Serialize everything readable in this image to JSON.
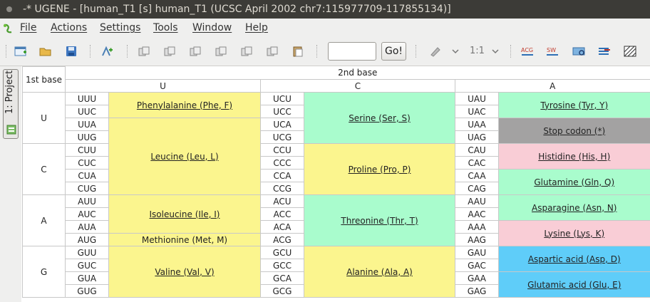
{
  "window": {
    "title": "-* UGENE - [human_T1 [s] human_T1 (UCSC April 2002 chr7:115977709-117855134)]"
  },
  "menu": [
    "File",
    "Actions",
    "Settings",
    "Tools",
    "Window",
    "Help"
  ],
  "toolbar": {
    "go_label": "Go!",
    "zoom_label": "1:1",
    "goto_value": ""
  },
  "side_panel": {
    "project_tab": "1: Project"
  },
  "table": {
    "first_base_header": "1st base",
    "second_base_header": "2nd base",
    "second_bases": [
      "U",
      "C",
      "A"
    ],
    "rows": [
      {
        "base": "U",
        "codons": [
          [
            "UUU",
            "UUC",
            "UUA",
            "UUG"
          ],
          [
            "UCU",
            "UCC",
            "UCA",
            "UCG"
          ],
          [
            "UAU",
            "UAC",
            "UAA",
            "UAG"
          ]
        ]
      },
      {
        "base": "C",
        "codons": [
          [
            "CUU",
            "CUC",
            "CUA",
            "CUG"
          ],
          [
            "CCU",
            "CCC",
            "CCA",
            "CCG"
          ],
          [
            "CAU",
            "CAC",
            "CAA",
            "CAG"
          ]
        ]
      },
      {
        "base": "A",
        "codons": [
          [
            "AUU",
            "AUC",
            "AUA",
            "AUG"
          ],
          [
            "ACU",
            "ACC",
            "ACA",
            "ACG"
          ],
          [
            "AAU",
            "AAC",
            "AAA",
            "AAG"
          ]
        ]
      },
      {
        "base": "G",
        "codons": [
          [
            "GUU",
            "GUC",
            "GUA",
            "GUG"
          ],
          [
            "GCU",
            "GCC",
            "GCA",
            "GCG"
          ],
          [
            "GAU",
            "GAC",
            "GAA",
            "GAG"
          ]
        ]
      }
    ],
    "amino_acids": {
      "phe": "Phenylalanine (Phe, F)",
      "leu": "Leucine (Leu, L)",
      "ile": "Isoleucine (Ile, I)",
      "met": "Methionine (Met, M)",
      "val": "Valine (Val, V)",
      "ser": "Serine (Ser, S)",
      "pro": "Proline (Pro, P)",
      "thr": "Threonine (Thr, T)",
      "ala": "Alanine (Ala, A)",
      "tyr": "Tyrosine (Tyr, Y)",
      "stop": "Stop codon (*)",
      "his": "Histidine (His, H)",
      "gln": "Glutamine (Gln, Q)",
      "asn": "Asparagine (Asn, N)",
      "lys": "Lysine (Lys, K)",
      "asp": "Aspartic acid (Asp, D)",
      "glu": "Glutamic acid (Glu, E)"
    },
    "colors": {
      "nonpolar": "#fbf58e",
      "polar": "#a9fccd",
      "stop": "#a3a2a2",
      "basic": "#f9cdd6",
      "acidic": "#5fcdf9"
    }
  }
}
